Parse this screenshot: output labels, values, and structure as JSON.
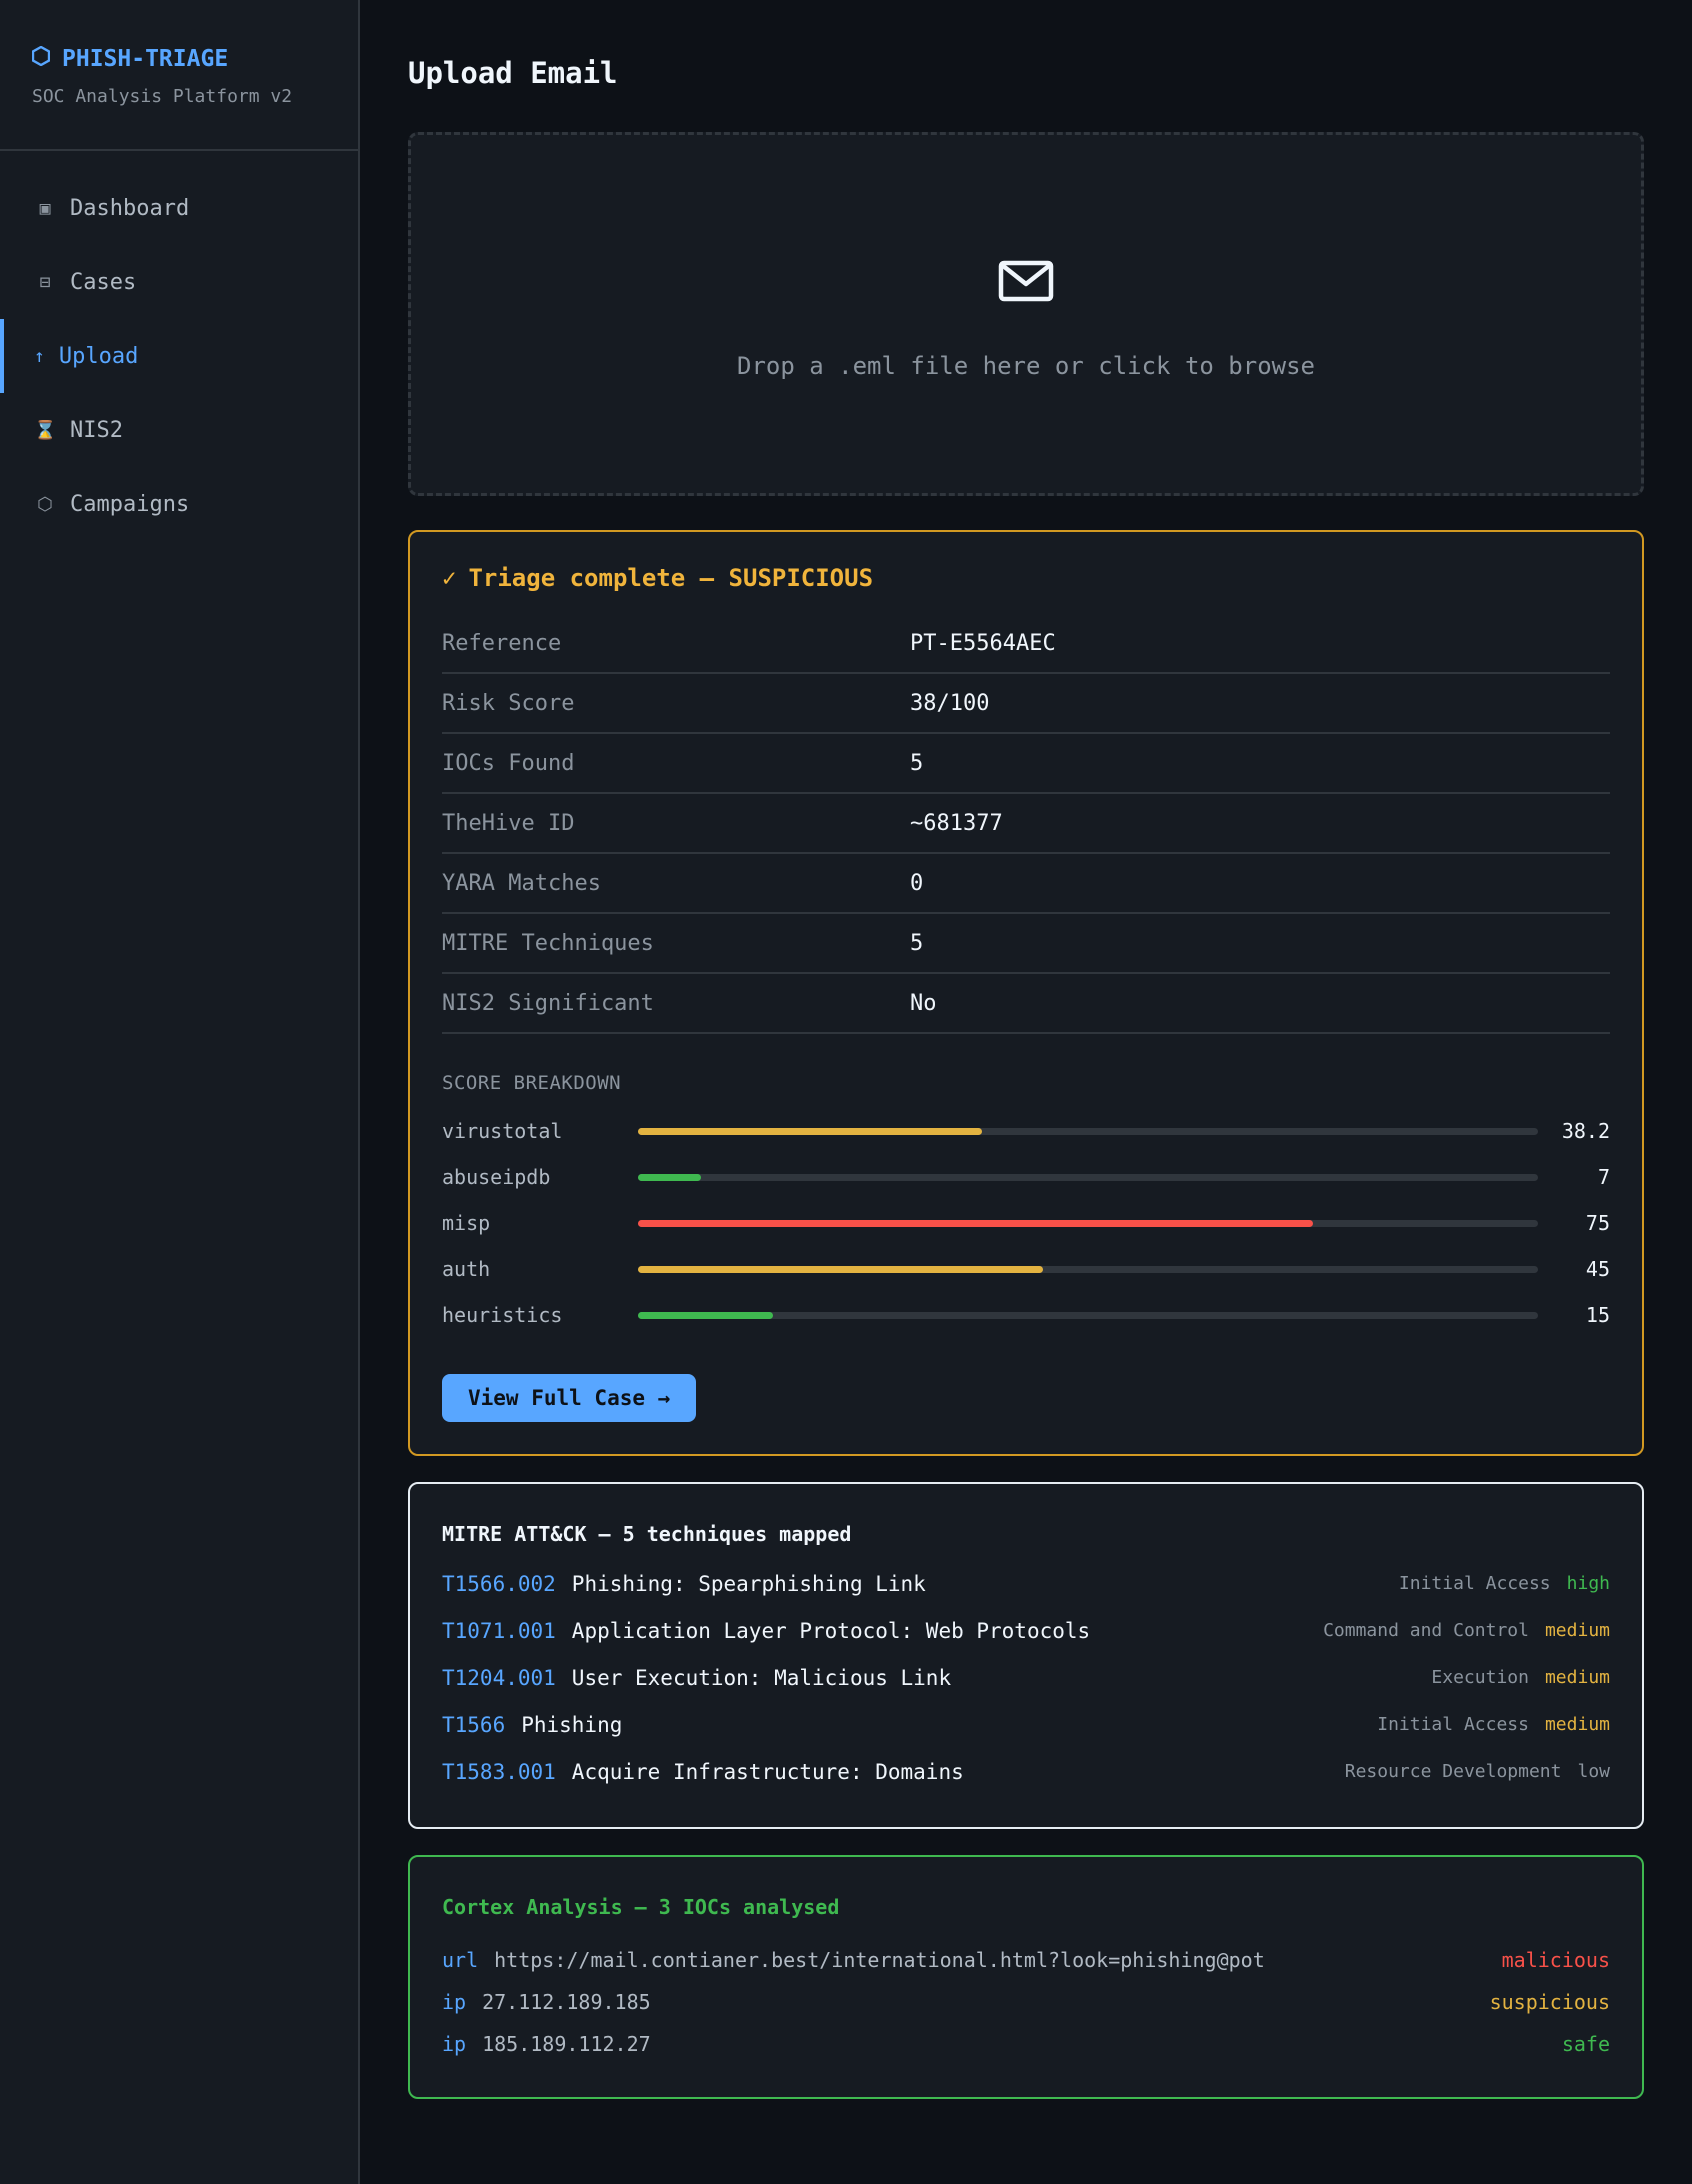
{
  "brand": {
    "icon": "hexagon-icon",
    "title": "PHISH-TRIAGE",
    "subtitle": "SOC Analysis Platform v2"
  },
  "nav": {
    "items": [
      {
        "label": "Dashboard",
        "icon": "▣",
        "icon_name": "dashboard-icon",
        "active": false
      },
      {
        "label": "Cases",
        "icon": "⊟",
        "icon_name": "cases-icon",
        "active": false
      },
      {
        "label": "Upload",
        "icon": "↑",
        "icon_name": "upload-arrow-icon",
        "active": true
      },
      {
        "label": "NIS2",
        "icon": "⌛",
        "icon_name": "hourglass-icon",
        "active": false
      },
      {
        "label": "Campaigns",
        "icon": "⬡",
        "icon_name": "campaigns-icon",
        "active": false
      }
    ]
  },
  "page": {
    "title": "Upload Email"
  },
  "dropzone": {
    "icon": "envelope-icon",
    "text": "Drop a .eml file here or click to browse"
  },
  "triage": {
    "check": "✓",
    "title": "Triage complete — SUSPICIOUS",
    "rows": [
      {
        "key": "Reference",
        "value": "PT-E5564AEC"
      },
      {
        "key": "Risk Score",
        "value": "38/100"
      },
      {
        "key": "IOCs Found",
        "value": "5"
      },
      {
        "key": "TheHive ID",
        "value": "~681377"
      },
      {
        "key": "YARA Matches",
        "value": "0"
      },
      {
        "key": "MITRE Techniques",
        "value": "5"
      },
      {
        "key": "NIS2 Significant",
        "value": "No"
      }
    ],
    "breakdown_title": "SCORE BREAKDOWN",
    "breakdown": [
      {
        "label": "virustotal",
        "value": "38.2",
        "fraction": 0.382,
        "color": "#e3b341"
      },
      {
        "label": "abuseipdb",
        "value": "7",
        "fraction": 0.07,
        "color": "#3fb950"
      },
      {
        "label": "misp",
        "value": "75",
        "fraction": 0.75,
        "color": "#f85149"
      },
      {
        "label": "auth",
        "value": "45",
        "fraction": 0.45,
        "color": "#e3b341"
      },
      {
        "label": "heuristics",
        "value": "15",
        "fraction": 0.15,
        "color": "#3fb950"
      }
    ],
    "button_label": "View Full Case →"
  },
  "mitre": {
    "title": "MITRE ATT&CK — 5 techniques mapped",
    "techniques": [
      {
        "id": "T1566.002",
        "name": "Phishing: Spearphishing Link",
        "tactic": "Initial Access",
        "severity": "high",
        "severity_color": "#3fb950"
      },
      {
        "id": "T1071.001",
        "name": "Application Layer Protocol: Web Protocols",
        "tactic": "Command and Control",
        "severity": "medium",
        "severity_color": "#e3b341"
      },
      {
        "id": "T1204.001",
        "name": "User Execution: Malicious Link",
        "tactic": "Execution",
        "severity": "medium",
        "severity_color": "#e3b341"
      },
      {
        "id": "T1566",
        "name": "Phishing",
        "tactic": "Initial Access",
        "severity": "medium",
        "severity_color": "#e3b341"
      },
      {
        "id": "T1583.001",
        "name": "Acquire Infrastructure: Domains",
        "tactic": "Resource Development",
        "severity": "low",
        "severity_color": "#8b949e"
      }
    ]
  },
  "cortex": {
    "title": "Cortex Analysis — 3 IOCs analysed",
    "iocs": [
      {
        "type": "url",
        "value": "https://mail.contianer.best/international.html?look=phishing@pot",
        "verdict": "malicious",
        "verdict_color": "#f85149"
      },
      {
        "type": "ip",
        "value": "27.112.189.185",
        "verdict": "suspicious",
        "verdict_color": "#e3b341"
      },
      {
        "type": "ip",
        "value": "185.189.112.27",
        "verdict": "safe",
        "verdict_color": "#3fb950"
      }
    ]
  }
}
